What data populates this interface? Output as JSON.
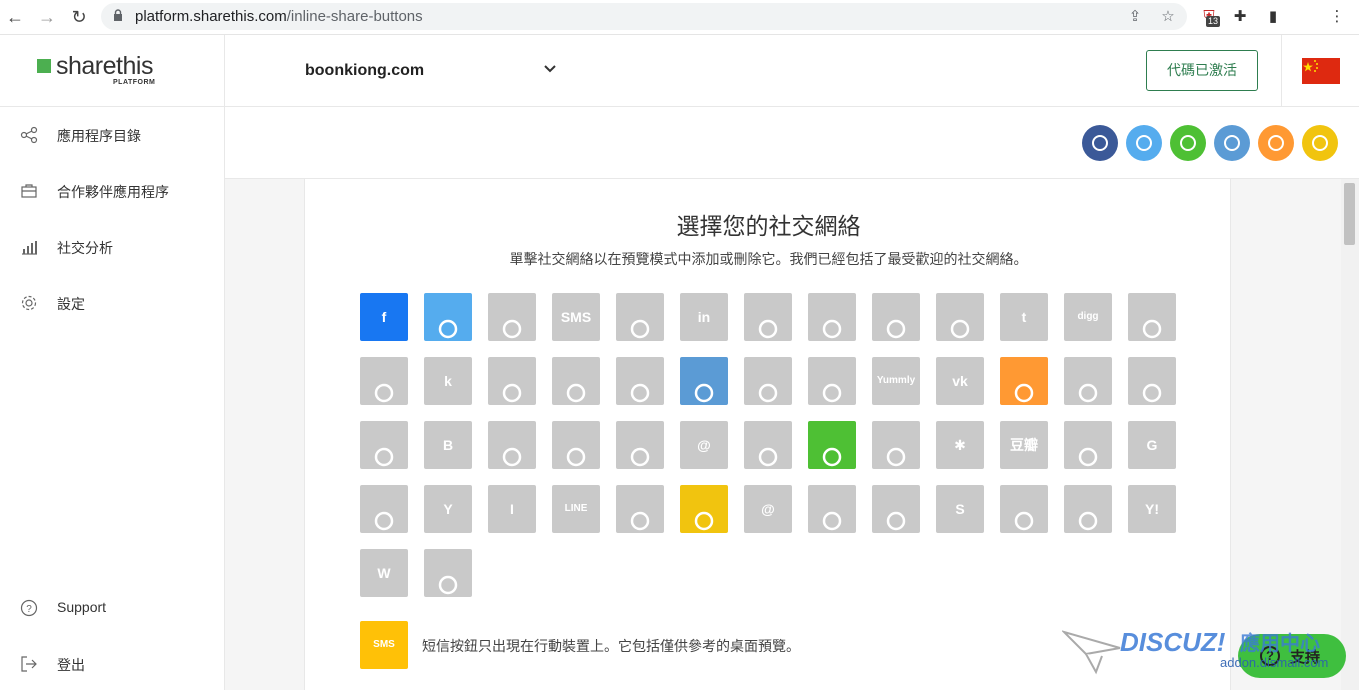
{
  "browser": {
    "url_host": "platform.sharethis.com",
    "url_path": "/inline-share-buttons",
    "extension_badge": "13"
  },
  "sidebar": {
    "logo_word": "sharethis",
    "logo_sub": "PLATFORM",
    "items": [
      {
        "label": "應用程序目錄",
        "icon": "share-nodes-icon"
      },
      {
        "label": "合作夥伴應用程序",
        "icon": "briefcase-icon"
      },
      {
        "label": "社交分析",
        "icon": "analytics-bars-icon"
      },
      {
        "label": "設定",
        "icon": "gear-icon"
      }
    ],
    "bottom_items": [
      {
        "label": "Support",
        "icon": "help-circle-icon"
      },
      {
        "label": "登出",
        "icon": "logout-icon"
      }
    ]
  },
  "topbar": {
    "domain": "boonkiong.com",
    "activate_label": "代碼已激活"
  },
  "preview_buttons": [
    {
      "name": "facebook",
      "color": "#3b5998"
    },
    {
      "name": "twitter",
      "color": "#55acee"
    },
    {
      "name": "wechat",
      "color": "#4ec034"
    },
    {
      "name": "qq",
      "color": "#5b9bd5"
    },
    {
      "name": "weibo",
      "color": "#ff9933"
    },
    {
      "name": "qzone",
      "color": "#f1c40f"
    }
  ],
  "panel": {
    "title": "選擇您的社交網絡",
    "subtitle": "單擊社交網絡以在預覽模式中添加或刪除它。我們已經包括了最受歡迎的社交網絡。",
    "sms_note": "短信按鈕只出現在行動裝置上。它包括僅供參考的桌面預覽。",
    "sms_icon_text": "SMS"
  },
  "networks": [
    {
      "name": "facebook",
      "active": true,
      "color": "#1877f2",
      "text": "f"
    },
    {
      "name": "twitter",
      "active": true,
      "color": "#55acee",
      "text": ""
    },
    {
      "name": "email",
      "active": false,
      "text": ""
    },
    {
      "name": "sms",
      "active": false,
      "text": "SMS"
    },
    {
      "name": "sharethis",
      "active": false,
      "text": ""
    },
    {
      "name": "linkedin",
      "active": false,
      "text": "in"
    },
    {
      "name": "messenger",
      "active": false,
      "text": ""
    },
    {
      "name": "copy",
      "active": false,
      "text": ""
    },
    {
      "name": "pinterest",
      "active": false,
      "text": ""
    },
    {
      "name": "reddit",
      "active": false,
      "text": ""
    },
    {
      "name": "tumblr",
      "active": false,
      "text": "t"
    },
    {
      "name": "digg",
      "active": false,
      "text": "digg"
    },
    {
      "name": "whatsapp",
      "active": false,
      "text": ""
    },
    {
      "name": "refind",
      "active": false,
      "text": ""
    },
    {
      "name": "kik",
      "active": false,
      "text": "k"
    },
    {
      "name": "buffer-layers",
      "active": false,
      "text": ""
    },
    {
      "name": "diaspora",
      "active": false,
      "text": ""
    },
    {
      "name": "outlook",
      "active": false,
      "text": ""
    },
    {
      "name": "qq",
      "active": true,
      "color": "#5b9bd5",
      "text": ""
    },
    {
      "name": "trello",
      "active": false,
      "text": ""
    },
    {
      "name": "viber",
      "active": false,
      "text": ""
    },
    {
      "name": "yummly",
      "active": false,
      "text": "Yummly"
    },
    {
      "name": "vk",
      "active": false,
      "text": "vk"
    },
    {
      "name": "weibo",
      "active": true,
      "color": "#ff9933",
      "text": ""
    },
    {
      "name": "odnoklassniki",
      "active": false,
      "text": ""
    },
    {
      "name": "xing",
      "active": false,
      "text": ""
    },
    {
      "name": "print",
      "active": false,
      "text": ""
    },
    {
      "name": "blogger",
      "active": false,
      "text": "B"
    },
    {
      "name": "flipboard",
      "active": false,
      "text": ""
    },
    {
      "name": "snapchat",
      "active": false,
      "text": ""
    },
    {
      "name": "meneame",
      "active": false,
      "text": ""
    },
    {
      "name": "email-at",
      "active": false,
      "text": "@"
    },
    {
      "name": "livejournal",
      "active": false,
      "text": ""
    },
    {
      "name": "wechat",
      "active": true,
      "color": "#4ec034",
      "text": ""
    },
    {
      "name": "buffer",
      "active": false,
      "text": ""
    },
    {
      "name": "delicious",
      "active": false,
      "text": "✱"
    },
    {
      "name": "douban",
      "active": false,
      "text": "豆瓣"
    },
    {
      "name": "evernote",
      "active": false,
      "text": ""
    },
    {
      "name": "google",
      "active": false,
      "text": "G"
    },
    {
      "name": "gmail",
      "active": false,
      "text": ""
    },
    {
      "name": "hacker-news",
      "active": false,
      "text": "Y"
    },
    {
      "name": "instapaper",
      "active": false,
      "text": "I"
    },
    {
      "name": "line",
      "active": false,
      "text": "LINE"
    },
    {
      "name": "pocket",
      "active": false,
      "text": ""
    },
    {
      "name": "qzone",
      "active": true,
      "color": "#f1c40f",
      "text": ""
    },
    {
      "name": "mailru",
      "active": false,
      "text": "@"
    },
    {
      "name": "mix",
      "active": false,
      "text": ""
    },
    {
      "name": "surfingbird",
      "active": false,
      "text": ""
    },
    {
      "name": "skype",
      "active": false,
      "text": "S"
    },
    {
      "name": "telegram",
      "active": false,
      "text": ""
    },
    {
      "name": "tencent-weibo",
      "active": false,
      "text": ""
    },
    {
      "name": "yahoo",
      "active": false,
      "text": "Y!"
    },
    {
      "name": "wordpress",
      "active": false,
      "text": "W"
    },
    {
      "name": "wykop",
      "active": false,
      "text": ""
    }
  ],
  "support": {
    "label": "支持",
    "watermark_text": "DISCUZ!",
    "watermark_cn": "應用中心",
    "watermark_url": "addon.dismall.com"
  }
}
